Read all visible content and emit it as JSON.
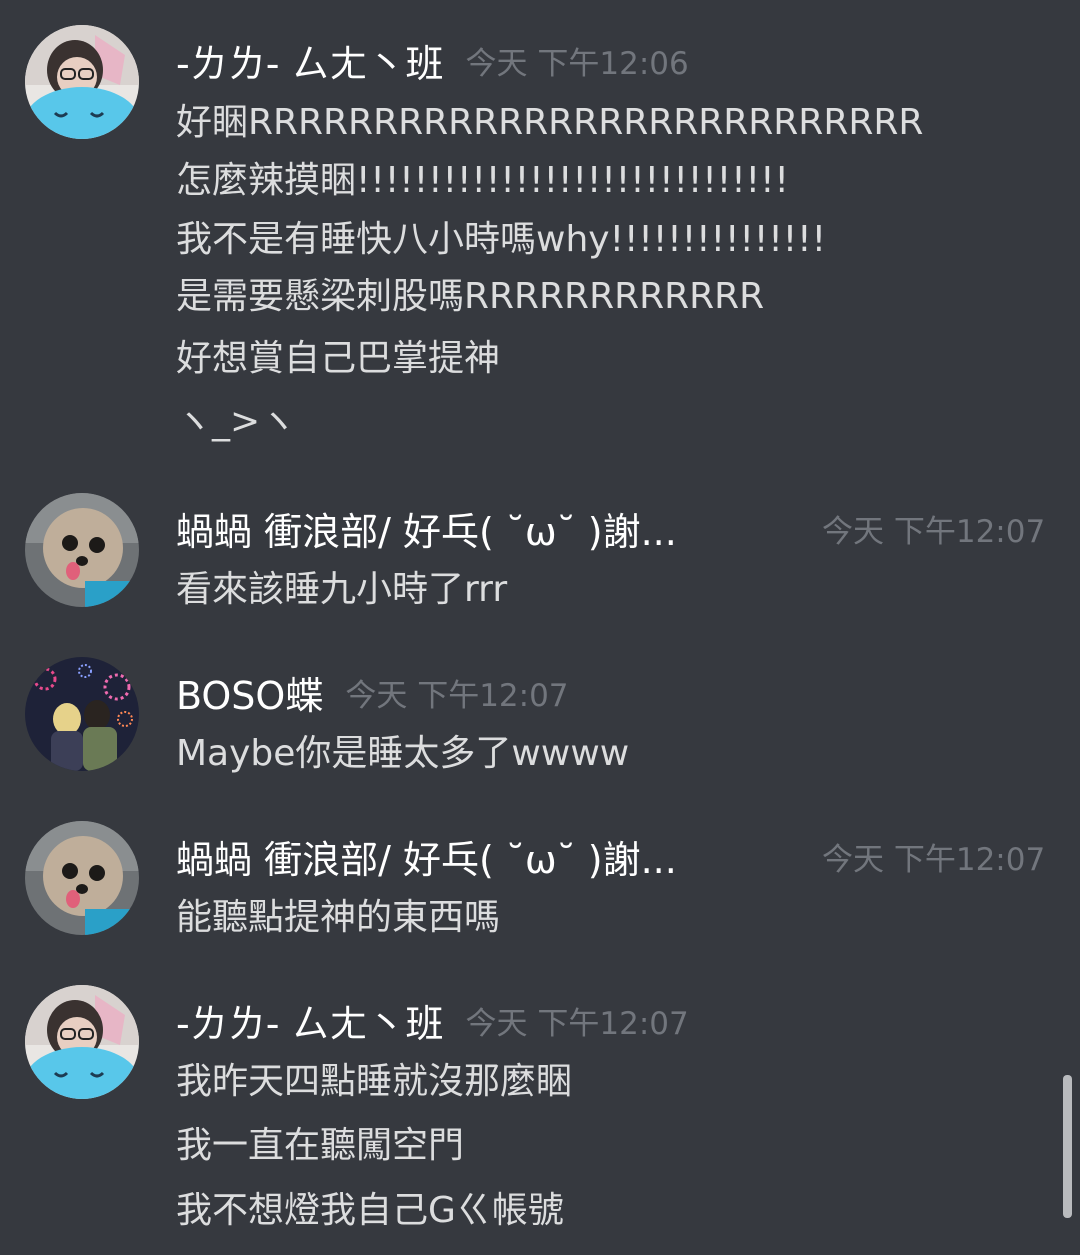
{
  "messages": [
    {
      "username": "-ㄌㄌ- ㄙㄤ丶班",
      "timestamp": "今天 下午12:06",
      "lines": [
        "好睏RRRRRRRRRRRRRRRRRRRRRRRRRRR",
        "怎麼辣摸睏!!!!!!!!!!!!!!!!!!!!!!!!!!!!!!",
        "我不是有睡快八小時嗎why!!!!!!!!!!!!!!!",
        "是需要懸梁刺股嗎RRRRRRRRRRRR",
        "好想賞自己巴掌提神",
        "ヽ_>ヽ"
      ]
    },
    {
      "username": "蝸蝸 衝浪部/ 好乓( ˘ω˘ )謝...",
      "timestamp": "今天 下午12:07",
      "lines": [
        "看來該睡九小時了rrr"
      ]
    },
    {
      "username": "BOSO蝶",
      "timestamp": "今天 下午12:07",
      "lines": [
        "Maybe你是睡太多了wwww"
      ]
    },
    {
      "username": "蝸蝸 衝浪部/ 好乓( ˘ω˘ )謝...",
      "timestamp": "今天 下午12:07",
      "lines": [
        "能聽點提神的東西嗎"
      ]
    },
    {
      "username": "-ㄌㄌ- ㄙㄤ丶班",
      "timestamp": "今天 下午12:07",
      "lines": [
        "我昨天四點睡就沒那麼睏",
        "我一直在聽闖空門",
        "我不想燈我自己Gㄍ帳號"
      ]
    }
  ]
}
